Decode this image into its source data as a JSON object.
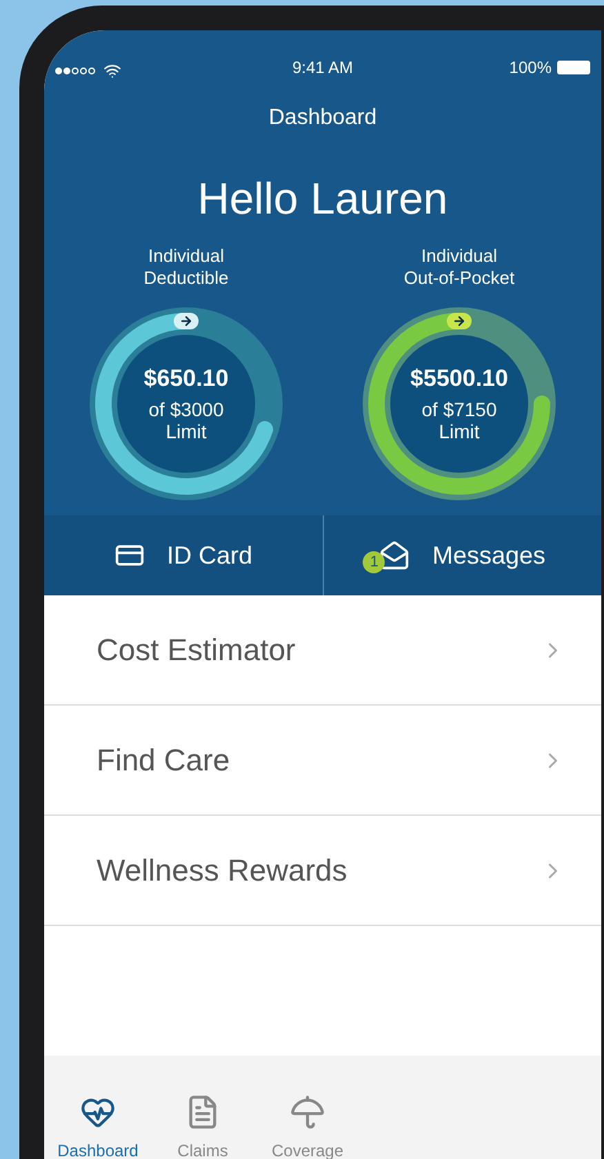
{
  "status_bar": {
    "time": "9:41 AM",
    "battery": "100%"
  },
  "nav": {
    "title": "Dashboard"
  },
  "greeting": "Hello Lauren",
  "meters": [
    {
      "kind": "teal",
      "label_line1": "Individual",
      "label_line2": "Deductible",
      "amount": "$650.10",
      "limit_line1": "of $3000",
      "limit_line2": "Limit",
      "level": 0.7
    },
    {
      "kind": "green",
      "label_line1": "Individual",
      "label_line2": "Out-of-Pocket",
      "amount": "$5500.10",
      "limit_line1": "of $7150",
      "limit_line2": "Limit",
      "level": 0.75
    }
  ],
  "quick_actions": [
    {
      "kind": "id",
      "label": "ID Card"
    },
    {
      "kind": "messages",
      "label": "Messages",
      "badge": "1"
    }
  ],
  "menu": [
    {
      "label": "Cost Estimator"
    },
    {
      "label": "Find Care"
    },
    {
      "label": "Wellness Rewards"
    }
  ],
  "tab_bar": [
    {
      "kind": "dashboard",
      "label": "Dashboard",
      "selected": true
    },
    {
      "kind": "claims",
      "label": "Claims",
      "selected": false
    },
    {
      "kind": "coverage",
      "label": "Coverage",
      "selected": false
    }
  ]
}
